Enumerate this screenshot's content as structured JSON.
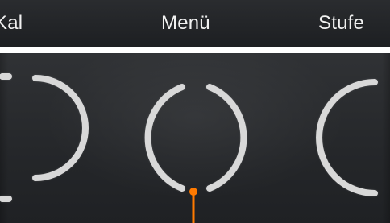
{
  "top_menu": {
    "kal_label": "Kal",
    "menu_label": "Menü",
    "stufe_label": "Stufe"
  },
  "cooking_zones": {
    "icon_names": [
      "left-cooking-zone-icon",
      "center-cooking-zone-icon",
      "right-cooking-zone-icon"
    ],
    "arc_color": "#d8d8d8",
    "active_indicator_color": "#ff7a00"
  },
  "colors": {
    "top_bar": "#1d1f22",
    "panel": "#25272a",
    "label": "#f1f1f1"
  }
}
